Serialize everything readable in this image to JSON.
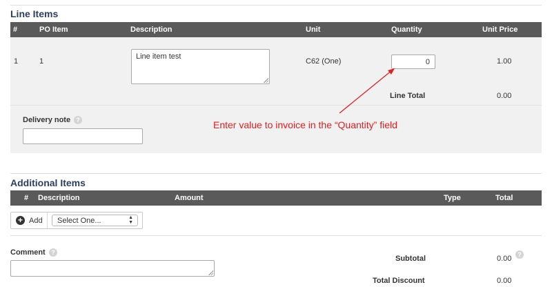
{
  "line_items": {
    "title": "Line Items",
    "columns": [
      "#",
      "PO Item",
      "Description",
      "Unit",
      "Quantity",
      "Unit Price"
    ],
    "rows": [
      {
        "num": "1",
        "po_item": "1",
        "description": "Line item test",
        "unit": "C62 (One)",
        "quantity": "0",
        "unit_price": "1.00"
      }
    ],
    "line_total_label": "Line Total",
    "line_total_value": "0.00",
    "delivery_note_label": "Delivery note",
    "delivery_note_value": ""
  },
  "annotation": {
    "text": "Enter value to invoice in the “Quantity” field",
    "color": "#e02020"
  },
  "additional_items": {
    "title": "Additional Items",
    "columns": [
      "#",
      "Description",
      "Amount",
      "Type",
      "Total"
    ],
    "add_label": "Add",
    "select_value": "Select One..."
  },
  "comment": {
    "label": "Comment",
    "value": ""
  },
  "totals": {
    "subtotal_label": "Subtotal",
    "subtotal_value": "0.00",
    "discount_label": "Total Discount",
    "discount_value": "0.00"
  },
  "icons": {
    "help": "question-circle-icon",
    "add": "plus-circle-icon",
    "select_arrows": "up-down-arrows-icon",
    "resize": "resize-grip-icon"
  }
}
